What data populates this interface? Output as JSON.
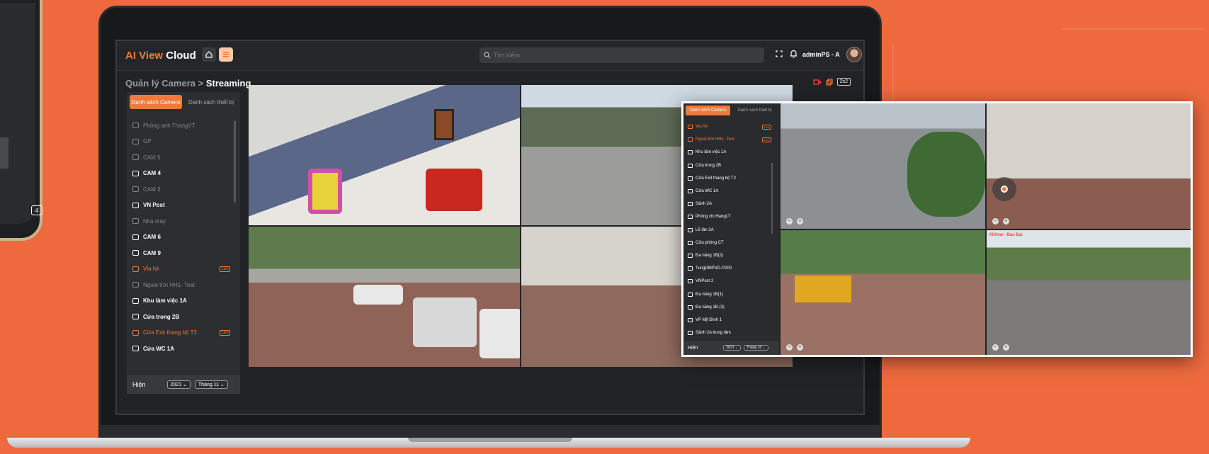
{
  "app": {
    "logo_ai": "AI View",
    "logo_cloud": "Cloud",
    "search_placeholder": "Tìm kiếm",
    "user_name": "adminPS - A",
    "grid_label": "2x2"
  },
  "breadcrumb": {
    "parent": "Quản lý Camera",
    "separator": ">",
    "current": "Streaming"
  },
  "sidebar": {
    "tabs": [
      "Danh sách Camera",
      "Danh sách thiết bị"
    ],
    "items": [
      {
        "label": "Phòng anh ThangVT",
        "state": "dim"
      },
      {
        "label": "GP",
        "state": "dim"
      },
      {
        "label": "CAM 5",
        "state": "dim"
      },
      {
        "label": "CAM 4",
        "state": "on"
      },
      {
        "label": "CAM 3",
        "state": "dim"
      },
      {
        "label": "VN Post",
        "state": "on"
      },
      {
        "label": "Nhà máy",
        "state": "dim"
      },
      {
        "label": "CAM 6",
        "state": "on"
      },
      {
        "label": "CAM 9",
        "state": "on"
      },
      {
        "label": "Vỉa hè",
        "state": "alert",
        "badge": "Live"
      },
      {
        "label": "Ngoài trời HH1- Test",
        "state": "dim"
      },
      {
        "label": "Khu làm việc 1A",
        "state": "on"
      },
      {
        "label": "Cửa trong 2B",
        "state": "on"
      },
      {
        "label": "Cửa Exit thang bộ T2",
        "state": "alert",
        "badge": "Live"
      },
      {
        "label": "Cửa WC 1A",
        "state": "on"
      }
    ],
    "footer": {
      "label": "Hiện",
      "year": "2021",
      "month": "Tháng 11"
    }
  },
  "overlay": {
    "tabs": [
      "Danh sách Camera",
      "Danh sách thiết bị"
    ],
    "items": [
      {
        "label": "Vỉa hè",
        "state": "alert",
        "badge": "Live"
      },
      {
        "label": "Ngoài trời HH1- Test",
        "state": "alert",
        "badge": "Live"
      },
      {
        "label": "Khu làm việc 1A",
        "state": "on"
      },
      {
        "label": "Cửa trong 2B",
        "state": "on"
      },
      {
        "label": "Cửa Exit thang bộ T2",
        "state": "on"
      },
      {
        "label": "Cửa WC 1A",
        "state": "on"
      },
      {
        "label": "Sảnh 2A",
        "state": "on"
      },
      {
        "label": "Phòng chị HangLT",
        "state": "on"
      },
      {
        "label": "Lễ tân 2A",
        "state": "on"
      },
      {
        "label": "Cửa phòng CT",
        "state": "on"
      },
      {
        "label": "Đa năng 1B(2)",
        "state": "on"
      },
      {
        "label": "TungDMPVD-P200",
        "state": "on"
      },
      {
        "label": "VNPost 2",
        "state": "on"
      },
      {
        "label": "Đa năng 1B(1)",
        "state": "on"
      },
      {
        "label": "Đa năng 1B (3)",
        "state": "on"
      },
      {
        "label": "VP Mỹ Đình 1",
        "state": "on"
      },
      {
        "label": "Sảnh 2A trung tâm",
        "state": "on"
      }
    ],
    "footer": {
      "label": "Hiện",
      "year": "2021",
      "month": "Tháng 10"
    },
    "video4_title": "AIView - Bảo Đại"
  },
  "colors": {
    "accent": "#f07a3c",
    "background": "#ee6a3e"
  }
}
